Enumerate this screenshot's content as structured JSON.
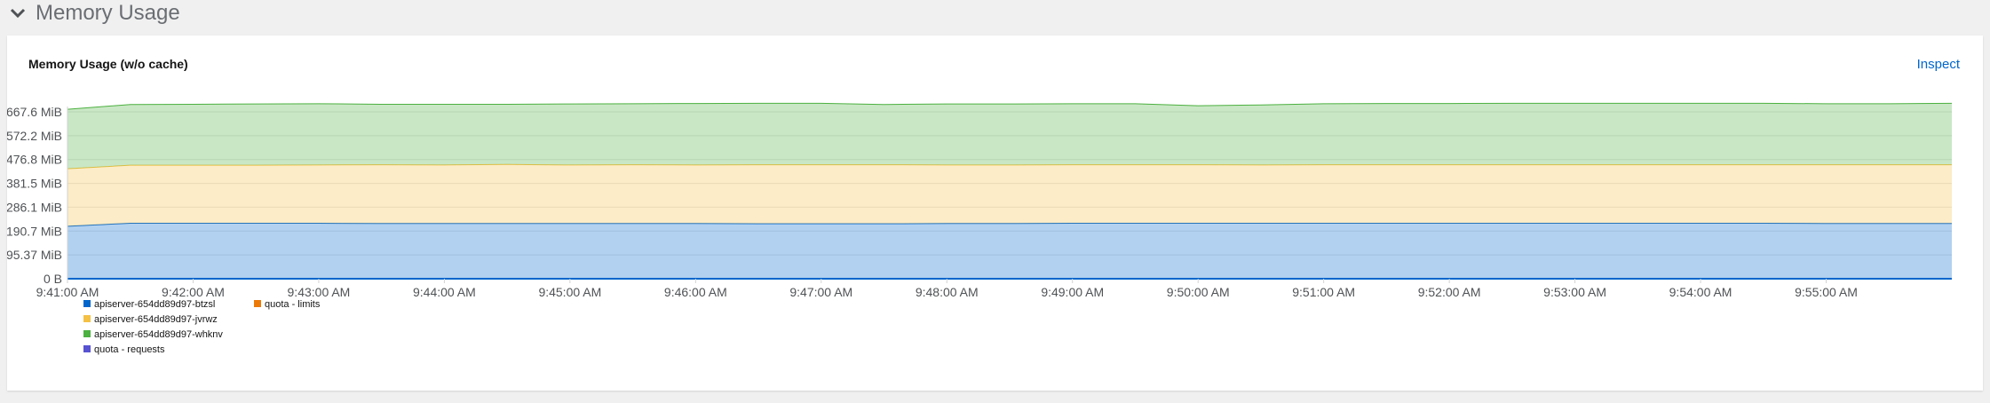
{
  "section": {
    "title": "Memory Usage"
  },
  "card": {
    "title": "Memory Usage (w/o cache)",
    "inspect_label": "Inspect"
  },
  "colors": {
    "btzsl": "#0066cc",
    "jvrwz": "#f4c145",
    "whknv": "#4cb140",
    "quota_limits": "#ec7a08",
    "quota_requests": "#5752d1"
  },
  "chart_data": {
    "type": "area",
    "stacked": true,
    "title": "Memory Usage (w/o cache)",
    "x": [
      "9:41:00 AM",
      "9:41:30 AM",
      "9:42:00 AM",
      "9:42:30 AM",
      "9:43:00 AM",
      "9:43:30 AM",
      "9:44:00 AM",
      "9:44:30 AM",
      "9:45:00 AM",
      "9:45:30 AM",
      "9:46:00 AM",
      "9:46:30 AM",
      "9:47:00 AM",
      "9:47:30 AM",
      "9:48:00 AM",
      "9:48:30 AM",
      "9:49:00 AM",
      "9:49:30 AM",
      "9:50:00 AM",
      "9:50:30 AM",
      "9:51:00 AM",
      "9:51:30 AM",
      "9:52:00 AM",
      "9:52:30 AM",
      "9:53:00 AM",
      "9:53:30 AM",
      "9:54:00 AM",
      "9:54:30 AM",
      "9:55:00 AM",
      "9:55:30 AM",
      "9:56:00 AM"
    ],
    "x_tick_labels": [
      "9:41:00 AM",
      "9:42:00 AM",
      "9:43:00 AM",
      "9:44:00 AM",
      "9:45:00 AM",
      "9:46:00 AM",
      "9:47:00 AM",
      "9:48:00 AM",
      "9:49:00 AM",
      "9:50:00 AM",
      "9:51:00 AM",
      "9:52:00 AM",
      "9:53:00 AM",
      "9:54:00 AM",
      "9:55:00 AM"
    ],
    "y_tick_labels": [
      "0 B",
      "95.37 MiB",
      "190.7 MiB",
      "286.1 MiB",
      "381.5 MiB",
      "476.8 MiB",
      "572.2 MiB",
      "667.6 MiB"
    ],
    "y_tick_values": [
      0,
      95.37,
      190.7,
      286.1,
      381.5,
      476.8,
      572.2,
      667.6
    ],
    "ylim": [
      0,
      667.6
    ],
    "unit": "MiB",
    "series": [
      {
        "name": "apiserver-654dd89d97-btzsl",
        "color": "#0066cc",
        "values": [
          210,
          222,
          222,
          222,
          222,
          221,
          221,
          221,
          221,
          221,
          221,
          220,
          220,
          220,
          221,
          221,
          222,
          222,
          222,
          222,
          222,
          222,
          222,
          222,
          222,
          222,
          222,
          222,
          221,
          221,
          221
        ]
      },
      {
        "name": "apiserver-654dd89d97-jvrwz",
        "color": "#f4c145",
        "values": [
          230,
          232,
          232,
          232,
          233,
          235,
          234,
          236,
          234,
          235,
          234,
          236,
          236,
          236,
          234,
          234,
          234,
          234,
          234,
          233,
          234,
          234,
          234,
          234,
          234,
          234,
          234,
          234,
          235,
          235,
          235
        ]
      },
      {
        "name": "apiserver-654dd89d97-whknv",
        "color": "#4cb140",
        "values": [
          238,
          243,
          244,
          245,
          245,
          242,
          243,
          241,
          244,
          244,
          246,
          246,
          246,
          241,
          244,
          244,
          244,
          244,
          236,
          240,
          244,
          245,
          245,
          246,
          246,
          246,
          246,
          246,
          244,
          244,
          246
        ]
      },
      {
        "name": "quota - limits",
        "color": "#ec7a08",
        "values": []
      },
      {
        "name": "quota - requests",
        "color": "#5752d1",
        "values": []
      }
    ],
    "legend": {
      "position": "bottom-left",
      "columns": [
        [
          "apiserver-654dd89d97-btzsl",
          "apiserver-654dd89d97-jvrwz",
          "apiserver-654dd89d97-whknv",
          "quota - requests"
        ],
        [
          "quota - limits"
        ]
      ]
    },
    "grid": true
  }
}
